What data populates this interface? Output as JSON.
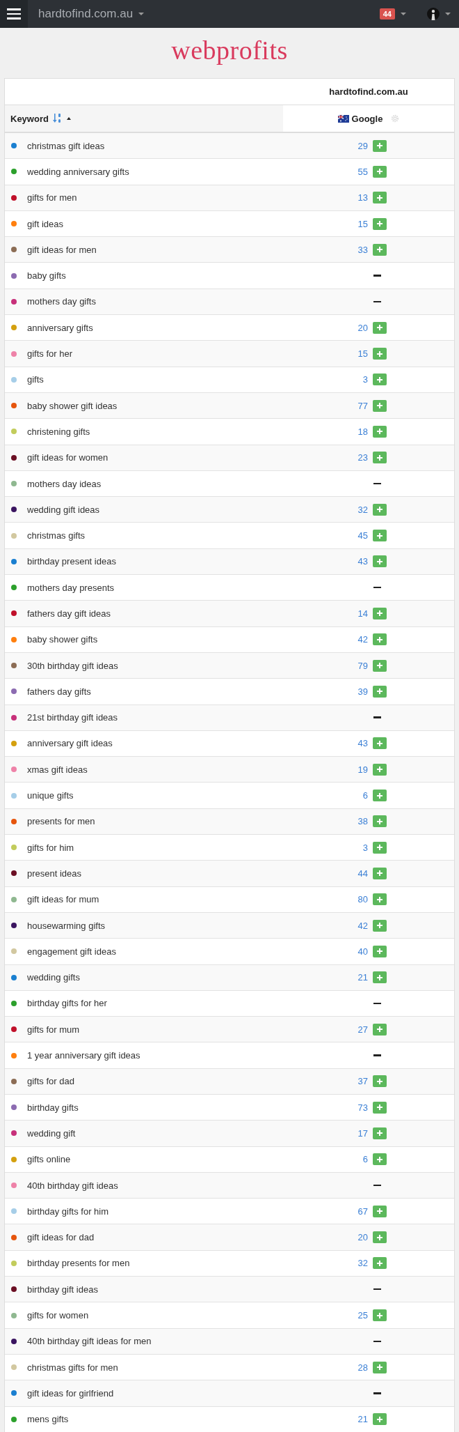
{
  "navbar": {
    "site": "hardtofind.com.au",
    "notifications": "44"
  },
  "logo": "webprofits",
  "table": {
    "domain": "hardtofind.com.au",
    "keyword_heading": "Keyword",
    "engine": "Google",
    "rows": [
      {
        "keyword": "christmas gift ideas",
        "color": "#1a7fd0",
        "rank": "29"
      },
      {
        "keyword": "wedding anniversary gifts",
        "color": "#2ca02c",
        "rank": "55"
      },
      {
        "keyword": "gifts for men",
        "color": "#c0102a",
        "rank": "13"
      },
      {
        "keyword": "gift ideas",
        "color": "#ff7f0e",
        "rank": "15"
      },
      {
        "keyword": "gift ideas for men",
        "color": "#8c6d55",
        "rank": "33"
      },
      {
        "keyword": "baby gifts",
        "color": "#8c6bb1",
        "rank": null
      },
      {
        "keyword": "mothers day gifts",
        "color": "#c7307a",
        "rank": null
      },
      {
        "keyword": "anniversary gifts",
        "color": "#d4a00f",
        "rank": "20"
      },
      {
        "keyword": "gifts for her",
        "color": "#ee82a8",
        "rank": "15"
      },
      {
        "keyword": "gifts",
        "color": "#a6cee8",
        "rank": "3"
      },
      {
        "keyword": "baby shower gift ideas",
        "color": "#e6550d",
        "rank": "77"
      },
      {
        "keyword": "christening gifts",
        "color": "#c2cc5c",
        "rank": "18"
      },
      {
        "keyword": "gift ideas for women",
        "color": "#6b0f24",
        "rank": "23"
      },
      {
        "keyword": "mothers day ideas",
        "color": "#8fb890",
        "rank": null
      },
      {
        "keyword": "wedding gift ideas",
        "color": "#3b1560",
        "rank": "32"
      },
      {
        "keyword": "christmas gifts",
        "color": "#d2c8a0",
        "rank": "45"
      },
      {
        "keyword": "birthday present ideas",
        "color": "#1a7fd0",
        "rank": "43"
      },
      {
        "keyword": "mothers day presents",
        "color": "#2ca02c",
        "rank": null
      },
      {
        "keyword": "fathers day gift ideas",
        "color": "#c0102a",
        "rank": "14"
      },
      {
        "keyword": "baby shower gifts",
        "color": "#ff7f0e",
        "rank": "42"
      },
      {
        "keyword": "30th birthday gift ideas",
        "color": "#8c6d55",
        "rank": "79"
      },
      {
        "keyword": "fathers day gifts",
        "color": "#8c6bb1",
        "rank": "39"
      },
      {
        "keyword": "21st birthday gift ideas",
        "color": "#c7307a",
        "rank": null
      },
      {
        "keyword": "anniversary gift ideas",
        "color": "#d4a00f",
        "rank": "43"
      },
      {
        "keyword": "xmas gift ideas",
        "color": "#ee82a8",
        "rank": "19"
      },
      {
        "keyword": "unique gifts",
        "color": "#a6cee8",
        "rank": "6"
      },
      {
        "keyword": "presents for men",
        "color": "#e6550d",
        "rank": "38"
      },
      {
        "keyword": "gifts for him",
        "color": "#c2cc5c",
        "rank": "3"
      },
      {
        "keyword": "present ideas",
        "color": "#6b0f24",
        "rank": "44"
      },
      {
        "keyword": "gift ideas for mum",
        "color": "#8fb890",
        "rank": "80"
      },
      {
        "keyword": "housewarming gifts",
        "color": "#3b1560",
        "rank": "42"
      },
      {
        "keyword": "engagement gift ideas",
        "color": "#d2c8a0",
        "rank": "40"
      },
      {
        "keyword": "wedding gifts",
        "color": "#1a7fd0",
        "rank": "21"
      },
      {
        "keyword": "birthday gifts for her",
        "color": "#2ca02c",
        "rank": null
      },
      {
        "keyword": "gifts for mum",
        "color": "#c0102a",
        "rank": "27"
      },
      {
        "keyword": "1 year anniversary gift ideas",
        "color": "#ff7f0e",
        "rank": null
      },
      {
        "keyword": "gifts for dad",
        "color": "#8c6d55",
        "rank": "37"
      },
      {
        "keyword": "birthday gifts",
        "color": "#8c6bb1",
        "rank": "73"
      },
      {
        "keyword": "wedding gift",
        "color": "#c7307a",
        "rank": "17"
      },
      {
        "keyword": "gifts online",
        "color": "#d4a00f",
        "rank": "6"
      },
      {
        "keyword": "40th birthday gift ideas",
        "color": "#ee82a8",
        "rank": null
      },
      {
        "keyword": "birthday gifts for him",
        "color": "#a6cee8",
        "rank": "67"
      },
      {
        "keyword": "gift ideas for dad",
        "color": "#e6550d",
        "rank": "20"
      },
      {
        "keyword": "birthday presents for men",
        "color": "#c2cc5c",
        "rank": "32"
      },
      {
        "keyword": "birthday gift ideas",
        "color": "#6b0f24",
        "rank": null
      },
      {
        "keyword": "gifts for women",
        "color": "#8fb890",
        "rank": "25"
      },
      {
        "keyword": "40th birthday gift ideas for men",
        "color": "#3b1560",
        "rank": null
      },
      {
        "keyword": "christmas gifts for men",
        "color": "#d2c8a0",
        "rank": "28"
      },
      {
        "keyword": "gift ideas for girlfriend",
        "color": "#1a7fd0",
        "rank": null
      },
      {
        "keyword": "mens gifts",
        "color": "#2ca02c",
        "rank": "21"
      }
    ]
  }
}
